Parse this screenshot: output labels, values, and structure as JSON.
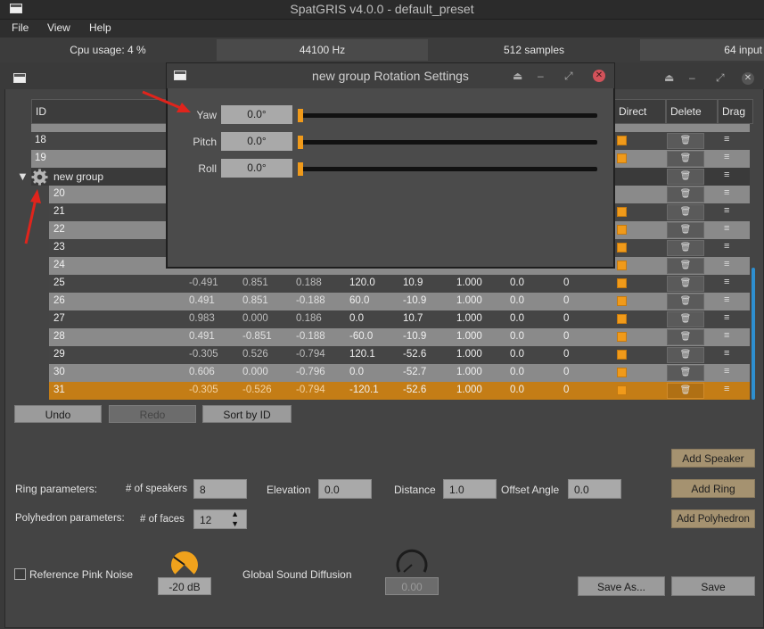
{
  "app": {
    "title": "SpatGRIS v4.0.0 - default_preset",
    "menu": [
      "File",
      "View",
      "Help"
    ],
    "status": {
      "cpu": "Cpu usage: 4 %",
      "rate": "44100 Hz",
      "buffer": "512 samples",
      "inputs": "64 input"
    }
  },
  "table": {
    "headers": {
      "id": "ID",
      "direct": "Direct",
      "delete": "Delete",
      "drag": "Drag"
    },
    "pre_rows": [
      "18",
      "19"
    ],
    "group_name": "new group",
    "group_rows_hidden": [
      "20",
      "21",
      "22",
      "23",
      "24"
    ],
    "rows": [
      {
        "id": "25",
        "x": "-0.491",
        "y": "0.851",
        "z": "0.188",
        "azim": "120.0",
        "elev": "10.9",
        "dist": "1.000",
        "gain": "0.0",
        "hpf": "0"
      },
      {
        "id": "26",
        "x": "0.491",
        "y": "0.851",
        "z": "-0.188",
        "azim": "60.0",
        "elev": "-10.9",
        "dist": "1.000",
        "gain": "0.0",
        "hpf": "0"
      },
      {
        "id": "27",
        "x": "0.983",
        "y": "0.000",
        "z": "0.186",
        "azim": "0.0",
        "elev": "10.7",
        "dist": "1.000",
        "gain": "0.0",
        "hpf": "0"
      },
      {
        "id": "28",
        "x": "0.491",
        "y": "-0.851",
        "z": "-0.188",
        "azim": "-60.0",
        "elev": "-10.9",
        "dist": "1.000",
        "gain": "0.0",
        "hpf": "0"
      },
      {
        "id": "29",
        "x": "-0.305",
        "y": "0.526",
        "z": "-0.794",
        "azim": "120.1",
        "elev": "-52.6",
        "dist": "1.000",
        "gain": "0.0",
        "hpf": "0"
      },
      {
        "id": "30",
        "x": "0.606",
        "y": "0.000",
        "z": "-0.796",
        "azim": "0.0",
        "elev": "-52.7",
        "dist": "1.000",
        "gain": "0.0",
        "hpf": "0"
      },
      {
        "id": "31",
        "x": "-0.305",
        "y": "-0.526",
        "z": "-0.794",
        "azim": "-120.1",
        "elev": "-52.6",
        "dist": "1.000",
        "gain": "0.0",
        "hpf": "0"
      }
    ]
  },
  "buttons": {
    "undo": "Undo",
    "redo": "Redo",
    "sort": "Sort by ID",
    "add_speaker": "Add Speaker",
    "add_ring": "Add Ring",
    "add_polyhedron": "Add Polyhedron",
    "save_as": "Save As...",
    "save": "Save"
  },
  "ring": {
    "label": "Ring parameters:",
    "speakers_label": "# of speakers",
    "speakers": "8",
    "elevation_label": "Elevation",
    "elevation": "0.0",
    "distance_label": "Distance",
    "distance": "1.0",
    "offset_label": "Offset Angle",
    "offset": "0.0"
  },
  "polyhedron": {
    "label": "Polyhedron parameters:",
    "faces_label": "# of faces",
    "faces": "12"
  },
  "pink_noise": {
    "label": "Reference Pink Noise",
    "level": "-20 dB",
    "knob_fraction": 0.3
  },
  "diffusion": {
    "label": "Global Sound Diffusion",
    "value": "0.00"
  },
  "dialog": {
    "title": "new group Rotation Settings",
    "yaw_label": "Yaw",
    "yaw": "0.0°",
    "pitch_label": "Pitch",
    "pitch": "0.0°",
    "roll_label": "Roll",
    "roll": "0.0°"
  },
  "colors": {
    "accent": "#f09a1a",
    "selected_row": "#c47d16",
    "button_gold": "#a59270"
  }
}
